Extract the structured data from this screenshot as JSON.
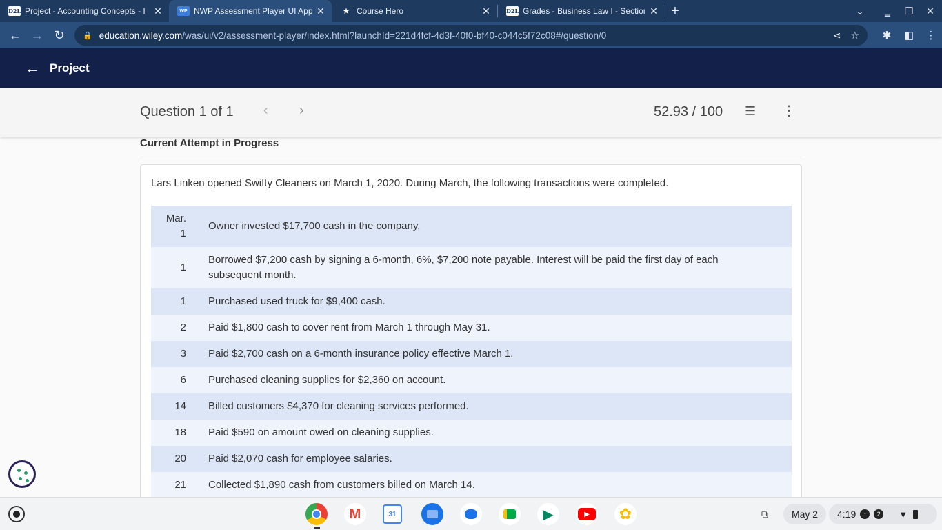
{
  "browser": {
    "tabs": [
      {
        "favicon": "D2L",
        "title": "Project - Accounting Concepts - I",
        "active": false
      },
      {
        "favicon": "WP",
        "title": "NWP Assessment Player UI App",
        "active": true
      },
      {
        "favicon": "★",
        "title": "Course Hero",
        "active": false
      },
      {
        "favicon": "D2L",
        "title": "Grades - Business Law I - Section",
        "active": false
      }
    ],
    "url_host": "education.wiley.com",
    "url_path": "/was/ui/v2/assessment-player/index.html?launchId=221d4fcf-4d3f-40f0-bf40-c044c5f72c08#/question/0"
  },
  "header": {
    "title": "Project"
  },
  "question_bar": {
    "label": "Question 1 of 1",
    "score": "52.93 / 100"
  },
  "content": {
    "attempt_label": "Current Attempt in Progress",
    "intro": "Lars Linken opened Swifty Cleaners on March 1, 2020. During March, the following transactions were completed.",
    "transactions": [
      {
        "date": "Mar.\n1",
        "description": "Owner invested $17,700 cash in the company."
      },
      {
        "date": "1",
        "description": "Borrowed $7,200 cash by signing a 6-month, 6%, $7,200 note payable. Interest will be paid the first day of each subsequent month."
      },
      {
        "date": "1",
        "description": "Purchased used truck for $9,400 cash."
      },
      {
        "date": "2",
        "description": "Paid $1,800 cash to cover rent from March 1 through May 31."
      },
      {
        "date": "3",
        "description": "Paid $2,700 cash on a 6-month insurance policy effective March 1."
      },
      {
        "date": "6",
        "description": "Purchased cleaning supplies for $2,360 on account."
      },
      {
        "date": "14",
        "description": "Billed customers $4,370 for cleaning services performed."
      },
      {
        "date": "18",
        "description": "Paid $590 on amount owed on cleaning supplies."
      },
      {
        "date": "20",
        "description": "Paid $2,070 cash for employee salaries."
      },
      {
        "date": "21",
        "description": "Collected $1,890 cash from customers billed on March 14."
      }
    ]
  },
  "shelf": {
    "date": "May 2",
    "time": "4:19",
    "notification_count": "2",
    "calendar_day": "31"
  },
  "colors": {
    "tab_strip": "#1f3a5f",
    "toolbar": "#2b4f7c",
    "app_header": "#13214a",
    "row_odd": "#dce6f7",
    "row_even": "#eef3fc"
  }
}
